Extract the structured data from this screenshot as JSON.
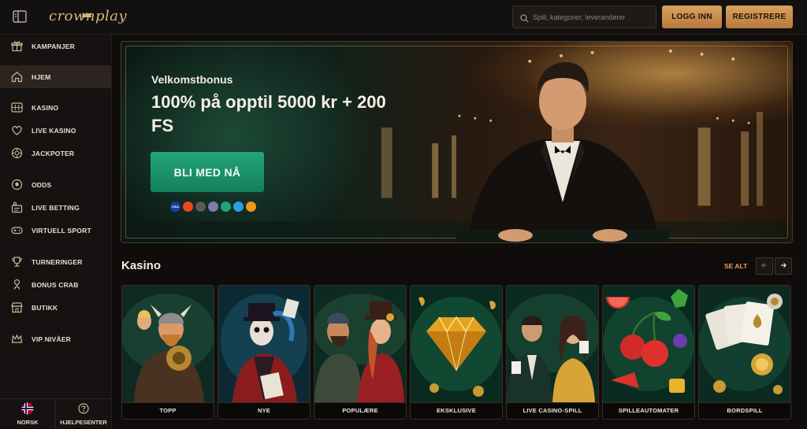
{
  "brand": {
    "logo_text": "crownplay",
    "accent": "#d9a15e",
    "cta_green": "#1c9670"
  },
  "header": {
    "search_placeholder": "Spill, kategorier, leverandører",
    "login_label": "LOGG INN",
    "register_label": "REGISTRERE"
  },
  "sidebar": {
    "items": [
      {
        "label": "KAMPANJER",
        "icon": "gift-icon"
      },
      {
        "label": "HJEM",
        "icon": "home-icon",
        "active": true
      },
      {
        "label": "KASINO",
        "icon": "slot-machine-icon"
      },
      {
        "label": "LIVE KASINO",
        "icon": "heart-dealer-icon"
      },
      {
        "label": "JACKPOTER",
        "icon": "chip-icon"
      },
      {
        "label": "ODDS",
        "icon": "football-icon"
      },
      {
        "label": "LIVE BETTING",
        "icon": "live-betting-icon"
      },
      {
        "label": "VIRTUELL SPORT",
        "icon": "gamepad-icon"
      },
      {
        "label": "TURNERINGER",
        "icon": "trophy-icon"
      },
      {
        "label": "BONUS CRAB",
        "icon": "claw-icon"
      },
      {
        "label": "BUTIKK",
        "icon": "shop-icon"
      },
      {
        "label": "VIP NIVÅER",
        "icon": "crown-icon"
      }
    ],
    "language_label": "NORSK",
    "help_label": "HJELPESENTER"
  },
  "hero": {
    "subtitle": "Velkomstbonus",
    "title": "100% på opptil 5000 kr + 200 FS",
    "cta_label": "BLI MED NÅ",
    "payment_icons": [
      {
        "name": "visa-icon",
        "text": "VISA",
        "color": "#1a3fa0"
      },
      {
        "name": "mastercard-icon",
        "text": "",
        "color": "#e84a1c"
      },
      {
        "name": "bank-icon",
        "text": "",
        "color": "#5a5a5a"
      },
      {
        "name": "ethereum-icon",
        "text": "",
        "color": "#7b7fa8"
      },
      {
        "name": "tether-icon",
        "text": "",
        "color": "#26a17b"
      },
      {
        "name": "crypto-icon",
        "text": "",
        "color": "#2aa0e0"
      },
      {
        "name": "bitcoin-icon",
        "text": "",
        "color": "#f29518"
      }
    ]
  },
  "section": {
    "title": "Kasino",
    "see_all_label": "SE ALT"
  },
  "categories": [
    {
      "label": "TOPP"
    },
    {
      "label": "NYE"
    },
    {
      "label": "POPULÆRE"
    },
    {
      "label": "EKSKLUSIVE"
    },
    {
      "label": "LIVE CASINO-SPILL"
    },
    {
      "label": "SPILLEAUTOMATER"
    },
    {
      "label": "BORDSPILL"
    }
  ]
}
